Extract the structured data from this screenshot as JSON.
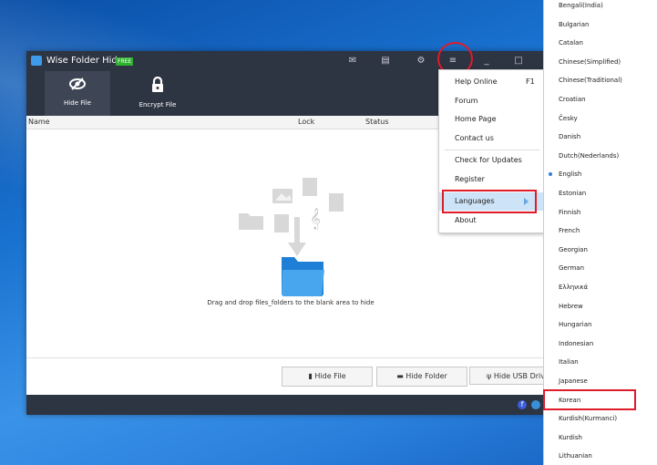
{
  "app": {
    "title": "Wise Folder Hider",
    "badge": "FREE"
  },
  "titlebar_icons": [
    "mail-icon",
    "feedback-icon",
    "settings-icon",
    "menu-icon",
    "minimize-icon",
    "maximize-icon"
  ],
  "toolbar": {
    "hide_file": "Hide File",
    "encrypt_file": "Encrypt File"
  },
  "columns": {
    "name": "Name",
    "lock": "Lock",
    "status": "Status"
  },
  "drop_hint": "Drag and drop files_folders to the blank area to hide",
  "buttons": {
    "hide_file": "Hide File",
    "hide_folder": "Hide Folder",
    "hide_usb": "Hide USB Drive"
  },
  "menu": {
    "help_online": "Help Online",
    "help_shortcut": "F1",
    "forum": "Forum",
    "home_page": "Home Page",
    "contact_us": "Contact us",
    "check_updates": "Check for Updates",
    "register": "Register",
    "languages": "Languages",
    "about": "About"
  },
  "languages": [
    "Bengali(India)",
    "Bulgarian",
    "Catalan",
    "Chinese(Simplified)",
    "Chinese(Traditional)",
    "Croatian",
    "Česky",
    "Danish",
    "Dutch(Nederlands)",
    "English",
    "Estonian",
    "Finnish",
    "French",
    "Georgian",
    "German",
    "Ελληνικά",
    "Hebrew",
    "Hungarian",
    "Indonesian",
    "Italian",
    "Japanese",
    "Korean",
    "Kurdish(Kurmanci)",
    "Kurdish",
    "Lithuanian"
  ],
  "selected_language": "English",
  "highlighted_language": "Korean",
  "colors": {
    "titlebar": "#2d3442",
    "highlight": "#e01b2a",
    "accent": "#2f7fd8",
    "folder": "#2d8fe0"
  }
}
